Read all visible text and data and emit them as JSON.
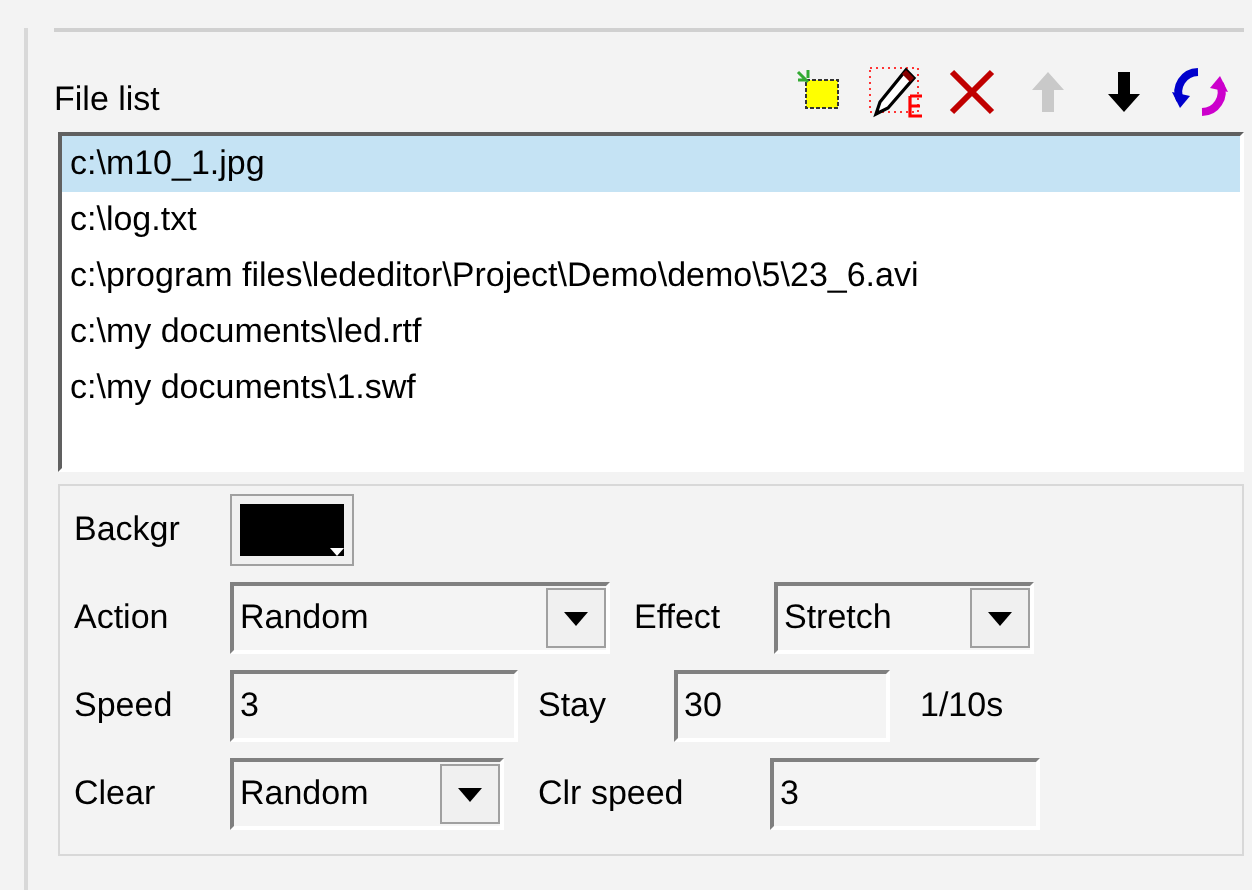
{
  "file_list": {
    "label": "File list",
    "toolbar": [
      {
        "kind": "add",
        "disabled": false
      },
      {
        "kind": "edit",
        "disabled": false
      },
      {
        "kind": "delete",
        "disabled": false
      },
      {
        "kind": "up",
        "disabled": true
      },
      {
        "kind": "down",
        "disabled": false
      },
      {
        "kind": "refresh",
        "disabled": false
      }
    ],
    "items": [
      {
        "text": "c:\\m10_1.jpg",
        "selected": true
      },
      {
        "text": "c:\\log.txt",
        "selected": false
      },
      {
        "text": "c:\\program files\\lededitor\\Project\\Demo\\demo\\5\\23_6.avi",
        "selected": false
      },
      {
        "text": "c:\\my documents\\led.rtf",
        "selected": false
      },
      {
        "text": "c:\\my documents\\1.swf",
        "selected": false
      }
    ]
  },
  "settings": {
    "background": {
      "label": "Backgr",
      "color": "#000000"
    },
    "action": {
      "label": "Action",
      "value": "Random"
    },
    "effect": {
      "label": "Effect",
      "value": "Stretch"
    },
    "speed": {
      "label": "Speed",
      "value": "3"
    },
    "stay": {
      "label": "Stay",
      "value": "30",
      "unit": "1/10s"
    },
    "clear": {
      "label": "Clear",
      "value": "Random"
    },
    "clr_speed": {
      "label": "Clr speed",
      "value": "3"
    }
  }
}
